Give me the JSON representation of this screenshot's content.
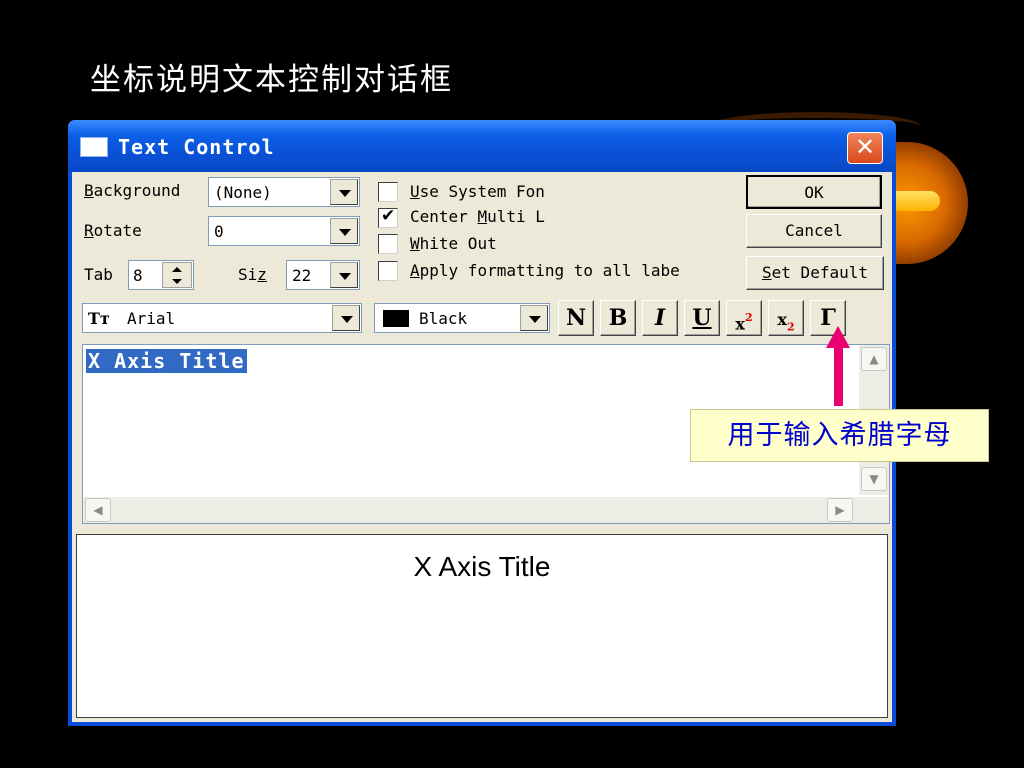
{
  "slide": {
    "title": "坐标说明文本控制对话框"
  },
  "window": {
    "title": "Text Control",
    "close_glyph": "✕"
  },
  "form": {
    "background": {
      "label_mnemonic": "B",
      "label_rest": "ackground",
      "value": "(None)"
    },
    "rotate": {
      "label_mnemonic": "R",
      "label_rest": "otate",
      "value": "0"
    },
    "tab": {
      "label": "Tab",
      "value": "8"
    },
    "size": {
      "label_a": "Si",
      "label_mnemonic": "z",
      "label_b": "e",
      "value": "22"
    },
    "font": {
      "glyph": "Tт",
      "value": "Arial"
    },
    "color": {
      "value": "Black",
      "swatch": "#000000"
    }
  },
  "checkboxes": [
    {
      "mnemonic": "U",
      "rest": "se System Fon",
      "checked": false
    },
    {
      "before": "Center ",
      "mnemonic": "M",
      "rest": "ulti L",
      "checked": true
    },
    {
      "mnemonic": "W",
      "rest": "hite Out",
      "checked": false
    },
    {
      "mnemonic": "A",
      "rest": "pply formatting to all labe",
      "checked": false
    }
  ],
  "buttons": {
    "ok": "OK",
    "cancel": "Cancel",
    "set_default_mnemonic": "S",
    "set_default_rest": "et Default"
  },
  "format_buttons": {
    "normal": "N",
    "bold": "B",
    "italic": "I",
    "underline": "U",
    "superscript_base": "x",
    "superscript_mark": "2",
    "subscript_base": "x",
    "subscript_mark": "2",
    "greek": "Γ"
  },
  "editor": {
    "text": "X Axis Title"
  },
  "preview": {
    "text": "X Axis Title"
  },
  "annotation": {
    "text": "用于输入希腊字母",
    "arrow_color": "#e8006e"
  },
  "colors": {
    "titlebar": "#0a4fd4",
    "selection": "#316ac5",
    "dialog_bg": "#ece9d8",
    "callout_text": "#0000cc"
  }
}
